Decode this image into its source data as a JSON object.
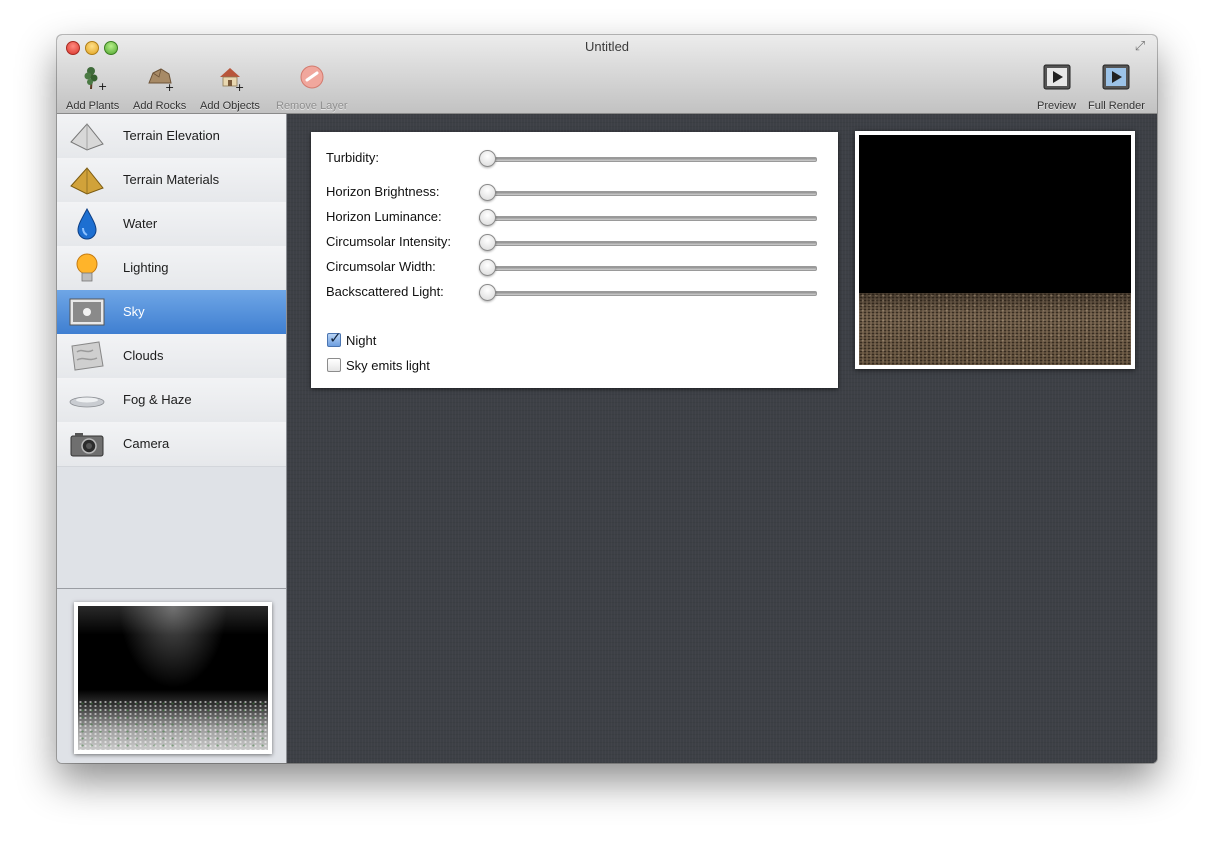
{
  "window": {
    "title": "Untitled"
  },
  "toolbar": {
    "add_plants": "Add Plants",
    "add_rocks": "Add Rocks",
    "add_objects": "Add Objects",
    "remove_layer": "Remove Layer",
    "preview": "Preview",
    "full_render": "Full Render"
  },
  "sidebar": {
    "items": [
      {
        "label": "Terrain Elevation",
        "icon": "terrain-elevation-icon"
      },
      {
        "label": "Terrain Materials",
        "icon": "terrain-materials-icon"
      },
      {
        "label": "Water",
        "icon": "water-drop-icon"
      },
      {
        "label": "Lighting",
        "icon": "light-bulb-icon"
      },
      {
        "label": "Sky",
        "icon": "sky-icon",
        "selected": true
      },
      {
        "label": "Clouds",
        "icon": "clouds-icon"
      },
      {
        "label": "Fog & Haze",
        "icon": "fog-icon"
      },
      {
        "label": "Camera",
        "icon": "camera-icon"
      }
    ]
  },
  "sky": {
    "sliders": [
      {
        "label": "Turbidity:",
        "value": 0
      },
      {
        "label": "Horizon Brightness:",
        "value": 0
      },
      {
        "label": "Horizon Luminance:",
        "value": 0
      },
      {
        "label": "Circumsolar Intensity:",
        "value": 0
      },
      {
        "label": "Circumsolar Width:",
        "value": 0
      },
      {
        "label": "Backscattered Light:",
        "value": 0
      }
    ],
    "night": {
      "label": "Night",
      "checked": true
    },
    "sky_emits_light": {
      "label": "Sky emits light",
      "checked": false
    }
  },
  "colors": {
    "selection": "#4a88d8",
    "main_bg": "#3d4046",
    "sidebar_bg": "#dfe2e7"
  }
}
